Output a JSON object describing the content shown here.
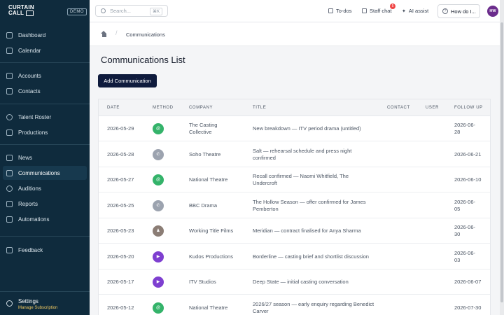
{
  "brand": {
    "line1": "CURTAIN",
    "line2": "CALL",
    "badge": "DEMO"
  },
  "sidebar": {
    "items": [
      {
        "label": "Dashboard",
        "icon": "dashboard-icon"
      },
      {
        "label": "Calendar",
        "icon": "calendar-icon"
      },
      {
        "label": "Accounts",
        "icon": "building-icon"
      },
      {
        "label": "Contacts",
        "icon": "contacts-icon"
      },
      {
        "label": "Talent Roster",
        "icon": "talent-icon"
      },
      {
        "label": "Productions",
        "icon": "productions-icon"
      },
      {
        "label": "News",
        "icon": "news-icon"
      },
      {
        "label": "Communications",
        "icon": "communications-icon",
        "active": true
      },
      {
        "label": "Auditions",
        "icon": "auditions-icon"
      },
      {
        "label": "Reports",
        "icon": "reports-icon"
      },
      {
        "label": "Automations",
        "icon": "automations-icon"
      },
      {
        "label": "Feedback",
        "icon": "feedback-icon"
      }
    ],
    "settings": {
      "label": "Settings",
      "sublabel": "Manage Subscription"
    }
  },
  "topbar": {
    "search_placeholder": "Search...",
    "search_shortcut": "⌘K",
    "todos": "To-dos",
    "staff_chat": "Staff chat",
    "staff_chat_badge": "5",
    "ai_assist": "AI assist",
    "help": "How do I...",
    "avatar_initials": "HW"
  },
  "breadcrumb": {
    "current": "Communications",
    "separator": "/"
  },
  "page": {
    "title": "Communications List",
    "add_button": "Add Communication"
  },
  "table": {
    "columns": [
      "DATE",
      "METHOD",
      "COMPANY",
      "TITLE",
      "CONTACT",
      "USER",
      "FOLLOW UP"
    ],
    "rows": [
      {
        "date": "2026-05-29",
        "method": "email",
        "company": [
          "The Casting",
          "Collective"
        ],
        "title": [
          "New breakdown — ITV period drama (untitled)"
        ],
        "contact": "",
        "user": "",
        "follow_up": [
          "2026-06-",
          "28"
        ]
      },
      {
        "date": "2026-05-28",
        "method": "phone",
        "company": [
          "Soho Theatre"
        ],
        "title": [
          "Salt — rehearsal schedule and press night",
          "confirmed"
        ],
        "contact": "",
        "user": "",
        "follow_up": [
          "2026-06-21"
        ]
      },
      {
        "date": "2026-05-27",
        "method": "email",
        "company": [
          "National Theatre"
        ],
        "title": [
          "Recall confirmed — Naomi Whitfield, The",
          "Undercroft"
        ],
        "contact": "",
        "user": "",
        "follow_up": [
          "2026-06-10"
        ]
      },
      {
        "date": "2026-05-25",
        "method": "phone",
        "company": [
          "BBC Drama"
        ],
        "title": [
          "The Hollow Season — offer confirmed for James",
          "Pemberton"
        ],
        "contact": "",
        "user": "",
        "follow_up": [
          "2026-06-",
          "05"
        ]
      },
      {
        "date": "2026-05-23",
        "method": "meeting",
        "company": [
          "Working Title Films"
        ],
        "title": [
          "Meridian — contract finalised for Anya Sharma"
        ],
        "contact": "",
        "user": "",
        "follow_up": [
          "2026-06-",
          "30"
        ]
      },
      {
        "date": "2026-05-20",
        "method": "video",
        "company": [
          "Kudos Productions"
        ],
        "title": [
          "Borderline — casting brief and shortlist discussion"
        ],
        "contact": "",
        "user": "",
        "follow_up": [
          "2026-06-",
          "03"
        ]
      },
      {
        "date": "2026-05-17",
        "method": "video",
        "company": [
          "ITV Studios"
        ],
        "title": [
          "Deep State — initial casting conversation"
        ],
        "contact": "",
        "user": "",
        "follow_up": [
          "2026-06-07"
        ]
      },
      {
        "date": "2026-05-12",
        "method": "email",
        "company": [
          "National Theatre"
        ],
        "title": [
          "2026/27 season — early enquiry regarding Benedict",
          "Carver"
        ],
        "contact": "",
        "user": "",
        "follow_up": [
          "2026-07-30"
        ]
      }
    ]
  },
  "method_icons": {
    "email": "@",
    "phone": "✆",
    "meeting": "♟",
    "video": "▶"
  },
  "colors": {
    "sidebar": "#0f2b3d",
    "primary_button": "#0f1b3d",
    "email": "#34b36a",
    "phone": "#9ca3af",
    "meeting": "#8b7d75",
    "video": "#7e3fd0",
    "subscription": "#f0c860"
  }
}
